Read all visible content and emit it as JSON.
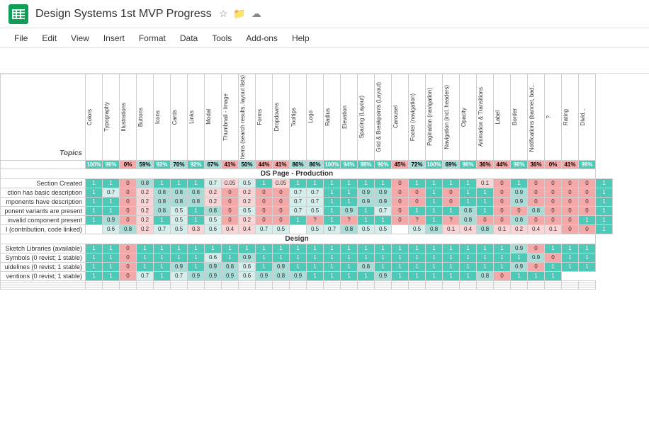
{
  "title": "Design Systems 1st MVP Progress",
  "menu": {
    "items": [
      "File",
      "Edit",
      "View",
      "Insert",
      "Format",
      "Data",
      "Tools",
      "Add-ons",
      "Help"
    ]
  },
  "columns": [
    "Topics",
    "Colors",
    "Typography",
    "Illustrations",
    "Buttons",
    "Icons",
    "Cards",
    "Links",
    "Modal",
    "Thumbnail - Image",
    "Items (search results, layout lists)",
    "Forms",
    "Dropdowns",
    "Tooltips",
    "Logo",
    "Radius",
    "Elevation",
    "Spacing (Layout)",
    "Grid & Breakpoints (Layout)",
    "Carousel",
    "Footer (navigation)",
    "Pagination (navigation)",
    "Navigation (incl. headers)",
    "Opacity",
    "Animation & Transitions",
    "Label",
    "Border",
    "Notifications (banner, bad...",
    "?",
    "Rating",
    "Divid..."
  ],
  "percentages": [
    "",
    "100%",
    "96%",
    "0%",
    "59%",
    "92%",
    "70%",
    "92%",
    "67%",
    "41%",
    "50%",
    "44%",
    "41%",
    "86%",
    "86%",
    "100%",
    "94%",
    "98%",
    "90%",
    "45%",
    "72%",
    "100%",
    "69%",
    "96%",
    "36%",
    "44%",
    "96%",
    "36%",
    "0%",
    "41%",
    "99%"
  ],
  "sections": [
    {
      "title": "DS Page - Production",
      "rows": [
        {
          "label": "Section Created",
          "cells": [
            "1",
            "1",
            "0",
            "0.8",
            "1",
            "1",
            "1",
            "0.7",
            "0.05",
            "0.5",
            "1",
            "0.05",
            "1",
            "1",
            "1",
            "1",
            "1",
            "1",
            "0",
            "1",
            "1",
            "1",
            "1",
            "0.1",
            "0",
            "1",
            "0",
            "0",
            "0",
            "0",
            "1"
          ]
        },
        {
          "label": "ction has basic description",
          "cells": [
            "1",
            "0.7",
            "0",
            "0.2",
            "0.8",
            "0.8",
            "0.8",
            "0.2",
            "0",
            "0.2",
            "0",
            "0",
            "0.7",
            "0.7",
            "1",
            "1",
            "0.9",
            "0.9",
            "0",
            "0",
            "1",
            "0",
            "1",
            "1",
            "0",
            "0.9",
            "0",
            "0",
            "0",
            "0",
            "1"
          ]
        },
        {
          "label": "mponents have description",
          "cells": [
            "1",
            "1",
            "0",
            "0.2",
            "0.8",
            "0.8",
            "0.8",
            "0.2",
            "0",
            "0.2",
            "0",
            "0",
            "0.7",
            "0.7",
            "1",
            "1",
            "0.9",
            "0.9",
            "0",
            "0",
            "1",
            "0",
            "1",
            "1",
            "0",
            "0.9",
            "0",
            "0",
            "0",
            "0",
            "1"
          ]
        },
        {
          "label": "ponent variants are present",
          "cells": [
            "1",
            "1",
            "0",
            "0.2",
            "0.8",
            "0.5",
            "1",
            "0.8",
            "0",
            "0.5",
            "0",
            "0",
            "0.7",
            "0.5",
            "1",
            "0.9",
            "1",
            "0.7",
            "0",
            "1",
            "1",
            "1",
            "0.8",
            "1",
            "0",
            "0",
            "0.8",
            "0",
            "0",
            "0",
            "1"
          ]
        },
        {
          "label": "invalid component present",
          "cells": [
            "1",
            "0.9",
            "0",
            "0.2",
            "1",
            "0.5",
            "1",
            "0.5",
            "0",
            "0.2",
            "0",
            "0",
            "1",
            "?",
            "1",
            "?",
            "1",
            "1",
            "0",
            "?",
            "1",
            "?",
            "0.8",
            "0",
            "0",
            "0.8",
            "0",
            "0",
            "0",
            "1",
            "1"
          ]
        },
        {
          "label": "I (contribution, code linked)",
          "cells": [
            "",
            "0.6",
            "0.8",
            "0.2",
            "0.7",
            "0.5",
            "0.3",
            "0.6",
            "0.4",
            "0.4",
            "0.7",
            "0.5",
            "",
            "0.5",
            "0.7",
            "0.8",
            "0.5",
            "0.5",
            "",
            "0.5",
            "0.8",
            "0.1",
            "0.4",
            "0.8",
            "0.1",
            "0.2",
            "0.4",
            "0.1",
            "0",
            "0",
            "1"
          ]
        }
      ]
    },
    {
      "title": "Design",
      "rows": [
        {
          "label": "Sketch Libraries (available)",
          "cells": [
            "1",
            "1",
            "0",
            "1",
            "1",
            "1",
            "1",
            "1",
            "1",
            "1",
            "1",
            "1",
            "1",
            "1",
            "1",
            "1",
            "1",
            "1",
            "1",
            "1",
            "1",
            "1",
            "1",
            "1",
            "1",
            "0.9",
            "0",
            "1",
            "1",
            "1"
          ]
        },
        {
          "label": "Symbols (0 revist; 1 stable)",
          "cells": [
            "1",
            "1",
            "0",
            "1",
            "1",
            "1",
            "1",
            "0.6",
            "1",
            "0.9",
            "1",
            "1",
            "1",
            "1",
            "1",
            "1",
            "1",
            "1",
            "1",
            "1",
            "1",
            "1",
            "1",
            "1",
            "1",
            "1",
            "0.9",
            "0",
            "1",
            "1"
          ]
        },
        {
          "label": "uidelines (0 revist; 1 stable)",
          "cells": [
            "1",
            "1",
            "0",
            "1",
            "1",
            "0.9",
            "1",
            "0.9",
            "0.8",
            "0.6",
            "1",
            "0.9",
            "1",
            "1",
            "1",
            "1",
            "0.8",
            "1",
            "1",
            "1",
            "1",
            "1",
            "1",
            "1",
            "1",
            "0.9",
            "0",
            "1",
            "1",
            "1"
          ]
        },
        {
          "label": "ventions (0 revist; 1 stable)",
          "cells": [
            "1",
            "1",
            "0",
            "0.7",
            "1",
            "0.7",
            "0.9",
            "0.9",
            "0.9",
            "0.6",
            "0.9",
            "0.8",
            "0.9",
            "1",
            "1",
            "1",
            "1",
            "0.9",
            "1",
            "1",
            "1",
            "1",
            "1",
            "0.8",
            "0",
            "1",
            "1",
            "1"
          ]
        }
      ]
    }
  ]
}
